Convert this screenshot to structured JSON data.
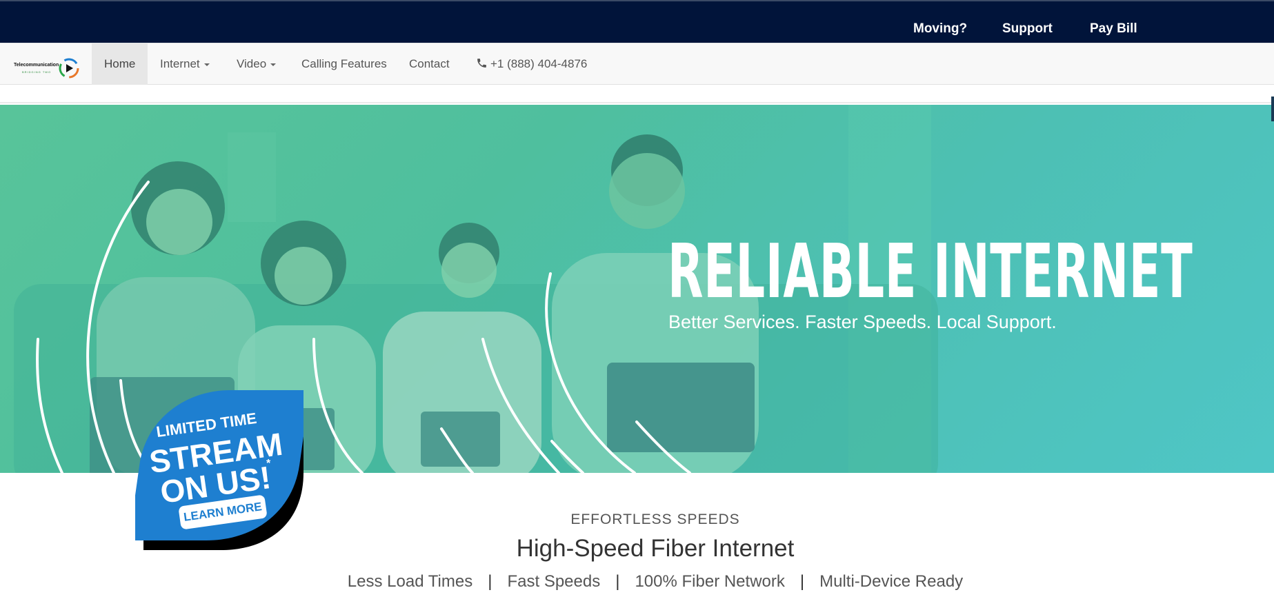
{
  "topbar": {
    "links": [
      {
        "label": "Moving?"
      },
      {
        "label": "Support"
      },
      {
        "label": "Pay Bill"
      }
    ]
  },
  "navbar": {
    "logo_text": "Telecommunication",
    "logo_subtext": "BRIDGING TWO",
    "items": [
      {
        "label": "Home",
        "active": true
      },
      {
        "label": "Internet",
        "dropdown": true
      },
      {
        "label": "Video",
        "dropdown": true
      },
      {
        "label": "Calling Features"
      },
      {
        "label": "Contact"
      }
    ],
    "phone": "+1 (888) 404-4876",
    "phone_icon": "phone-icon"
  },
  "hero": {
    "title": "RELIABLE INTERNET",
    "subtitle": "Better Services. Faster Speeds. Local Support."
  },
  "promo_badge": {
    "line1": "LIMITED TIME",
    "line2": "STREAM",
    "line3": "ON US!",
    "asterisk": "*",
    "cta": "LEARN MORE",
    "color": "#1e7fd0"
  },
  "section": {
    "kicker": "EFFORTLESS SPEEDS",
    "title": "High-Speed Fiber Internet",
    "features": [
      "Less Load Times",
      "Fast Speeds",
      "100% Fiber Network",
      "Multi-Device Ready"
    ],
    "separator": "|"
  },
  "colors": {
    "topbar": "#01143a",
    "hero_gradient_start": "#58c49a",
    "hero_gradient_end": "#4fc6c6",
    "badge_blue": "#1e7fd0"
  }
}
